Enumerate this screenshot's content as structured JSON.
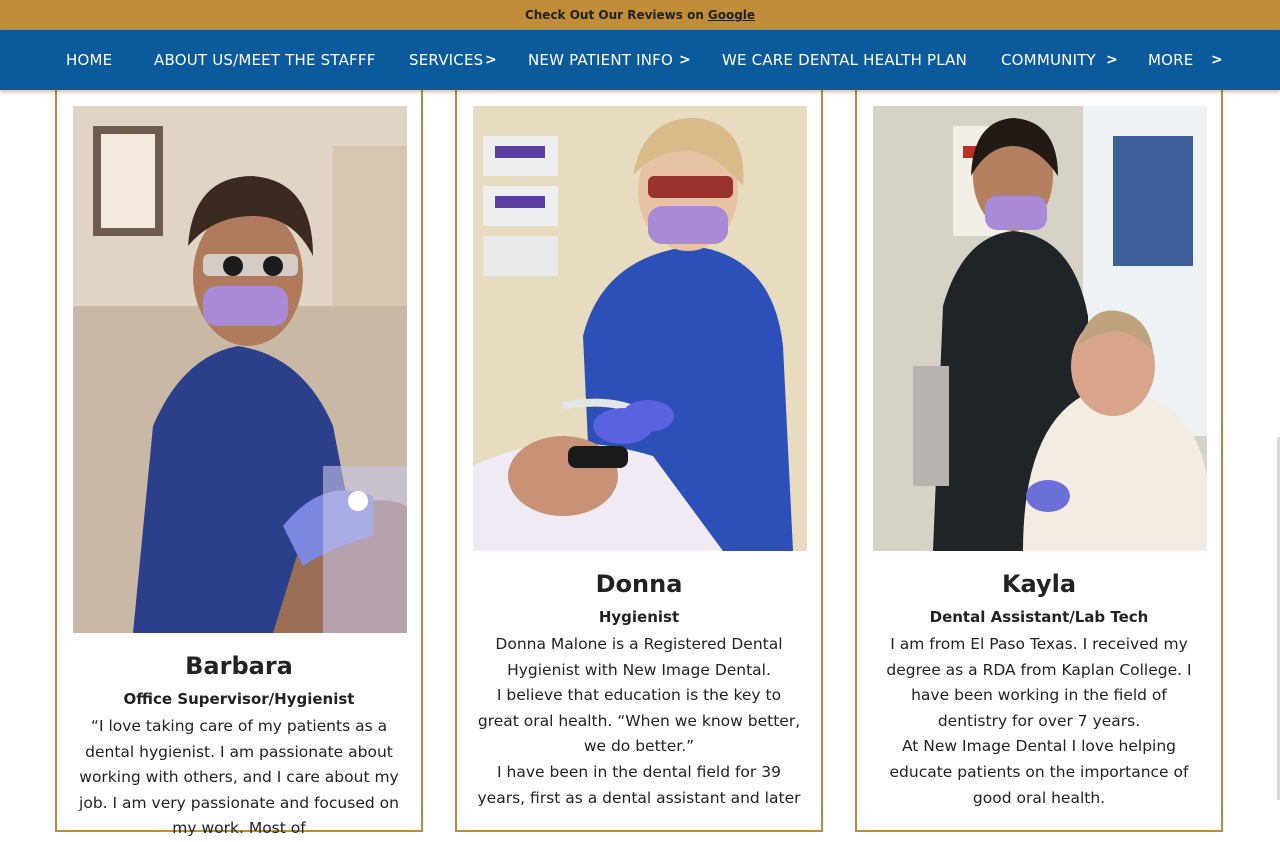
{
  "announcement": {
    "text": "Check Out Our Reviews on",
    "link": "Google"
  },
  "nav": {
    "items": [
      {
        "label": "HOME"
      },
      {
        "label": "ABOUT US/MEET THE STAFFF"
      },
      {
        "label": "SERVICES"
      },
      {
        "label": "NEW PATIENT INFO"
      },
      {
        "label": "WE CARE DENTAL HEALTH PLAN"
      },
      {
        "label": "COMMUNITY"
      },
      {
        "label": "MORE"
      }
    ],
    "chevron": ">"
  },
  "staff": [
    {
      "name": "Barbara",
      "role": "Office Supervisor/Hygienist",
      "bio": [
        "“I love taking care of my patients as a dental hygienist. I am passionate about working with others, and I care about my job. I am very passionate and focused on my work. Most of"
      ]
    },
    {
      "name": "Donna",
      "role": "Hygienist",
      "bio": [
        "Donna Malone is a Registered Dental Hygienist with New Image Dental.",
        "I believe that education is the key to great oral health.  “When we know better, we do better.”",
        "I have been in the dental field for 39 years, first as a dental assistant and later"
      ]
    },
    {
      "name": "Kayla",
      "role": "Dental Assistant/Lab Tech",
      "bio": [
        "I am from El Paso Texas. I received my degree as a RDA from Kaplan College. I have been working in the field of dentistry for over 7 years.",
        "At New Image Dental I love helping educate patients on the importance of good oral health."
      ]
    }
  ],
  "colors": {
    "gold": "#c18d3a",
    "navy": "#0b5a9c"
  }
}
